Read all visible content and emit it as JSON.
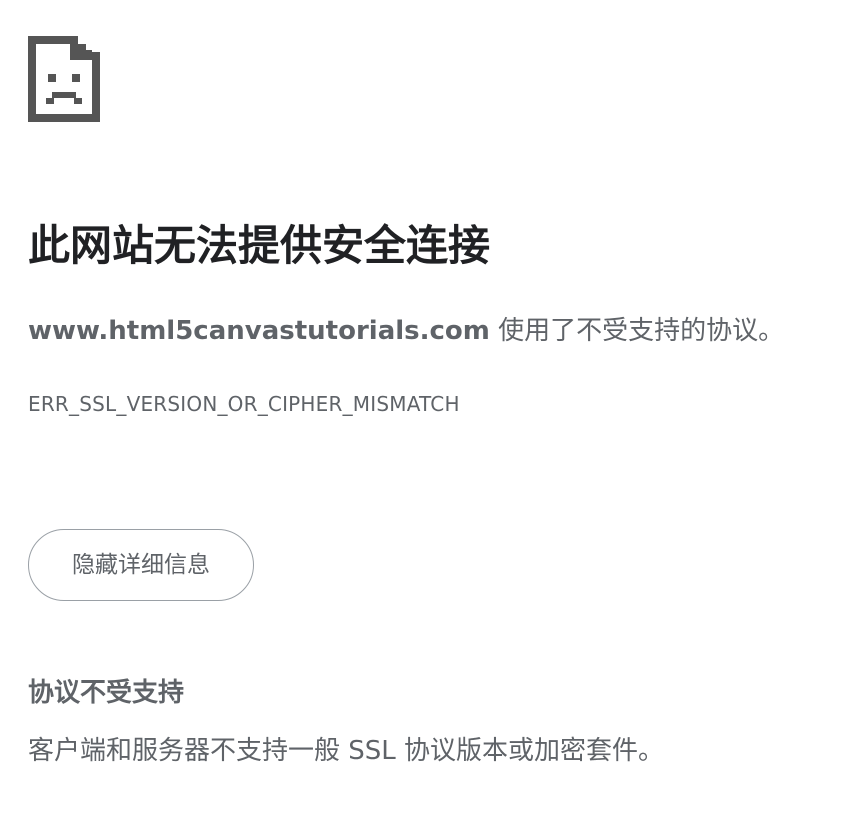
{
  "error_page": {
    "icon": "broken-page-sad-face-icon",
    "title": "此网站无法提供安全连接",
    "host": "www.html5canvastutorials.com",
    "message_suffix": " 使用了不受支持的协议。",
    "error_code": "ERR_SSL_VERSION_OR_CIPHER_MISMATCH",
    "details_button_label": "隐藏详细信息",
    "details": {
      "heading": "协议不受支持",
      "body": "客户端和服务器不支持一般 SSL 协议版本或加密套件。"
    }
  },
  "colors": {
    "background": "#ffffff",
    "title_text": "#202124",
    "secondary_text": "#5f6368",
    "icon": "#555555",
    "button_border": "#9aa0a6"
  }
}
